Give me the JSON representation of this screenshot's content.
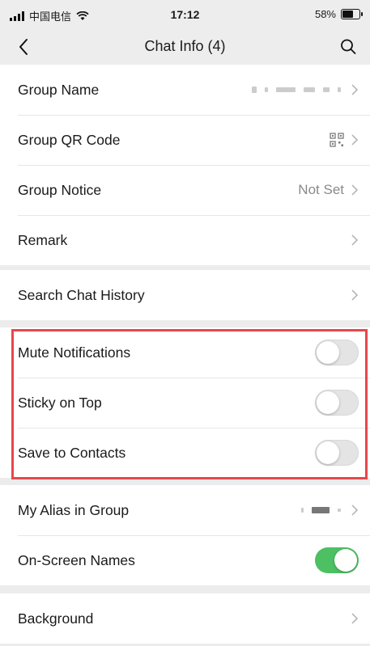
{
  "status": {
    "carrier": "中国电信",
    "time": "17:12",
    "battery": "58%"
  },
  "nav": {
    "title": "Chat Info (4)"
  },
  "group1": {
    "group_name": "Group Name",
    "group_qr": "Group QR Code",
    "group_notice": "Group Notice",
    "group_notice_value": "Not Set",
    "remark": "Remark"
  },
  "group2": {
    "search_history": "Search Chat History"
  },
  "group3": {
    "mute": "Mute Notifications",
    "sticky": "Sticky on Top",
    "save_contacts": "Save to Contacts"
  },
  "group4": {
    "alias": "My Alias in Group",
    "onscreen_names": "On-Screen Names"
  },
  "group5": {
    "background": "Background"
  },
  "toggles": {
    "mute": false,
    "sticky": false,
    "save_contacts": false,
    "onscreen_names": true
  },
  "colors": {
    "toggle_on": "#4cc062",
    "highlight": "#e8474b"
  },
  "icons": [
    "signal-icon",
    "wifi-icon",
    "battery-icon",
    "back-arrow-icon",
    "search-icon",
    "chevron-right-icon",
    "qr-code-icon"
  ]
}
